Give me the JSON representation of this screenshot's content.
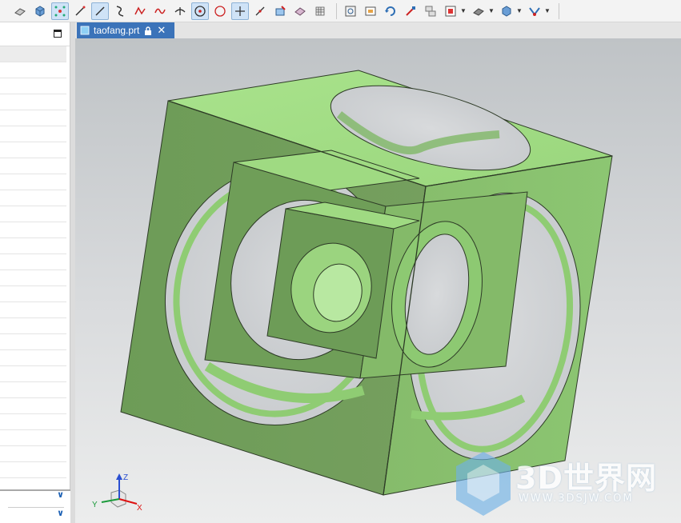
{
  "toolbar": {
    "groups": [
      [
        "shape-icon",
        "cube-icon",
        "snap-point-icon",
        "line-icon",
        "line-alt-icon",
        "curve-icon",
        "point-curve-icon",
        "spline-icon",
        "intersect-icon",
        "circle-center-icon",
        "circle-icon",
        "cross-icon",
        "tangent-line-icon",
        "sketch-icon",
        "shade-icon",
        "grid-icon"
      ],
      [
        "fit-view-icon",
        "zoom-window-icon",
        "rotate-icon",
        "pan-icon",
        "layer-icon",
        "orient-icon",
        "render-style-icon",
        "view-cube-icon",
        "snap-icon"
      ]
    ]
  },
  "tab": {
    "filename": "taofang.prt",
    "locked": true
  },
  "triad": {
    "x_label": "X",
    "y_label": "Y",
    "z_label": "Z"
  },
  "watermark": {
    "title": "3D世界网",
    "url": "WWW.3DSJW.COM"
  },
  "colors": {
    "model_face_light": "#a6e08a",
    "model_face_mid": "#8fcc73",
    "model_face_dark": "#6f9e58",
    "tab_bg": "#3b73b9",
    "accent": "#1a5fb4"
  }
}
